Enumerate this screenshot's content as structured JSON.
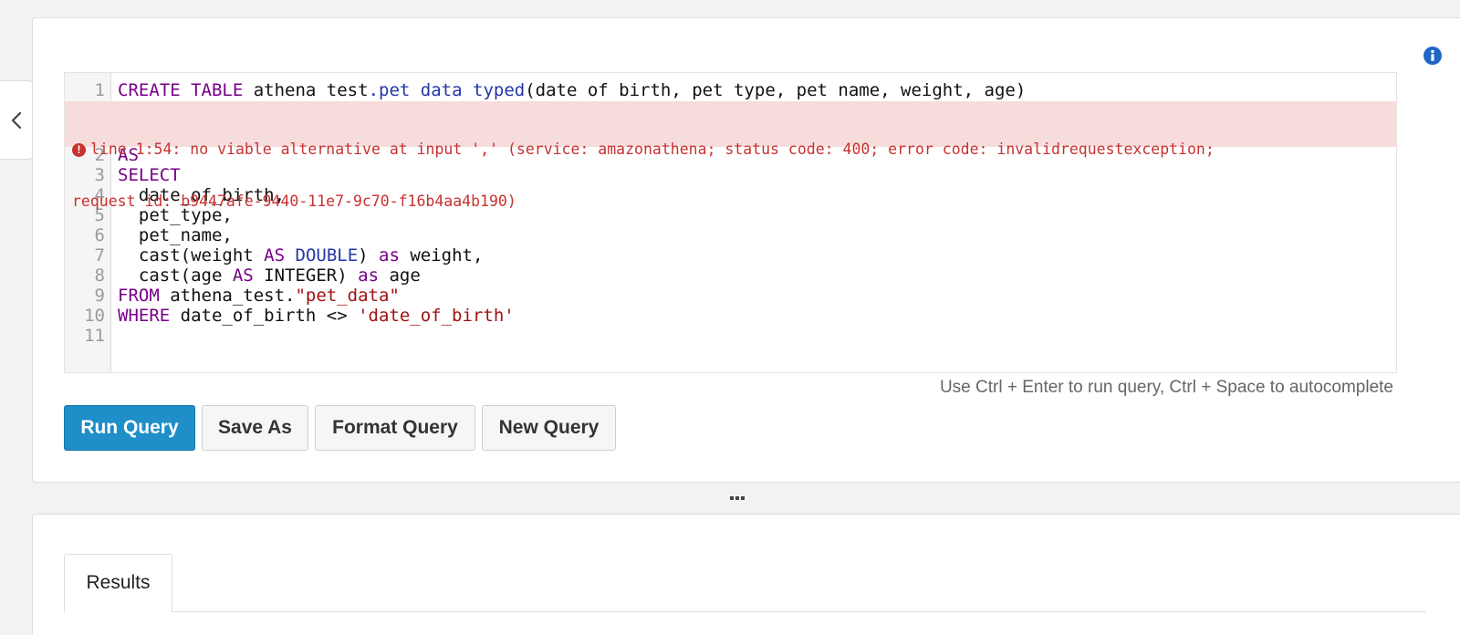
{
  "editor": {
    "lines": [
      {
        "num": "1",
        "parts": [
          {
            "t": "CREATE",
            "c": "kw"
          },
          {
            "t": " ",
            "c": ""
          },
          {
            "t": "TABLE",
            "c": "kw"
          },
          {
            "t": " athena test",
            "c": ""
          },
          {
            "t": ".pet",
            "c": "bl"
          },
          {
            "t": " ",
            "c": ""
          },
          {
            "t": "data",
            "c": "bl"
          },
          {
            "t": " ",
            "c": ""
          },
          {
            "t": "typed",
            "c": "bl"
          },
          {
            "t": "(date of birth, pet type, pet name, weight, age)",
            "c": ""
          }
        ]
      },
      {
        "num": "2",
        "parts": [
          {
            "t": "AS",
            "c": "kw"
          }
        ]
      },
      {
        "num": "3",
        "parts": [
          {
            "t": "SELECT",
            "c": "kw"
          }
        ]
      },
      {
        "num": "4",
        "parts": [
          {
            "t": "  date_of_birth,",
            "c": ""
          }
        ]
      },
      {
        "num": "5",
        "parts": [
          {
            "t": "  pet_type,",
            "c": ""
          }
        ]
      },
      {
        "num": "6",
        "parts": [
          {
            "t": "  pet_name,",
            "c": ""
          }
        ]
      },
      {
        "num": "7",
        "parts": [
          {
            "t": "  cast(weight ",
            "c": ""
          },
          {
            "t": "AS",
            "c": "kw"
          },
          {
            "t": " ",
            "c": ""
          },
          {
            "t": "DOUBLE",
            "c": "bl"
          },
          {
            "t": ") ",
            "c": ""
          },
          {
            "t": "as",
            "c": "kw"
          },
          {
            "t": " weight,",
            "c": ""
          }
        ]
      },
      {
        "num": "8",
        "parts": [
          {
            "t": "  cast(age ",
            "c": ""
          },
          {
            "t": "AS",
            "c": "kw"
          },
          {
            "t": " INTEGER) ",
            "c": ""
          },
          {
            "t": "as",
            "c": "kw"
          },
          {
            "t": " age",
            "c": ""
          }
        ]
      },
      {
        "num": "9",
        "parts": [
          {
            "t": "FROM",
            "c": "kw"
          },
          {
            "t": " athena_test.",
            "c": ""
          },
          {
            "t": "\"pet_data\"",
            "c": "st"
          }
        ]
      },
      {
        "num": "10",
        "parts": [
          {
            "t": "WHERE",
            "c": "kw"
          },
          {
            "t": " date_of_birth <> ",
            "c": ""
          },
          {
            "t": "'date_of_birth'",
            "c": "st"
          }
        ]
      },
      {
        "num": "11",
        "parts": []
      }
    ],
    "error_line1": "line 1:54: no viable alternative at input ',' (service: amazonathena; status code: 400; error code: invalidrequestexception;",
    "error_line2": "request id: b9447afe-9440-11e7-9c70-f16b4aa4b190)"
  },
  "hint": "Use Ctrl + Enter to run query, Ctrl + Space to autocomplete",
  "buttons": {
    "run": "Run Query",
    "save_as": "Save As",
    "format": "Format Query",
    "new": "New Query"
  },
  "results_tab": {
    "label": "Results"
  },
  "colors": {
    "primary": "#1f8ec9",
    "error_bg": "#f7dcdc",
    "error_text": "#c8312f",
    "info": "#1f66c4"
  },
  "icons": {
    "collapse": "chevron-left-icon",
    "info": "info-icon",
    "error": "exclamation-circle-icon",
    "splitter": "drag-handle-icon"
  }
}
